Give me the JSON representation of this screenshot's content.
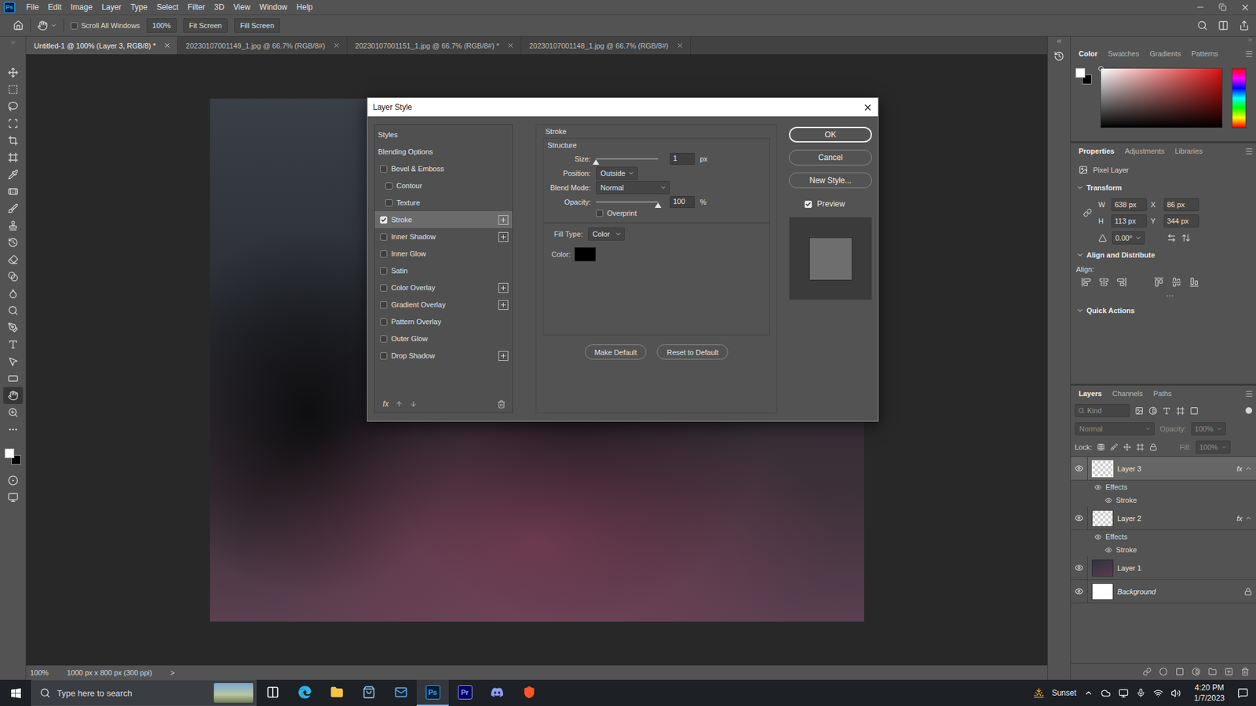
{
  "app": {
    "logo": "Ps"
  },
  "menu": [
    "File",
    "Edit",
    "Image",
    "Layer",
    "Type",
    "Select",
    "Filter",
    "3D",
    "View",
    "Window",
    "Help"
  ],
  "options_bar": {
    "scroll_all": {
      "label": "Scroll All Windows",
      "checked": false
    },
    "zoom": "100%",
    "buttons": [
      "Fit Screen",
      "Fill Screen"
    ]
  },
  "tabs": [
    {
      "label": "Untitled-1 @ 100% (Layer 3, RGB/8) *",
      "selected": true
    },
    {
      "label": "20230107001149_1.jpg @ 66.7% (RGB/8#)",
      "selected": false
    },
    {
      "label": "20230107001151_1.jpg @ 66.7% (RGB/8#) *",
      "selected": false
    },
    {
      "label": "20230107001148_1.jpg @ 66.7% (RGB/8#)",
      "selected": false
    }
  ],
  "tools": [
    {
      "selected": false
    },
    {
      "selected": false
    },
    {
      "selected": false
    },
    {
      "selected": false
    },
    {
      "selected": false
    },
    {
      "selected": false
    },
    {
      "selected": false
    },
    {
      "selected": false
    },
    {
      "selected": false
    },
    {
      "selected": false
    },
    {
      "selected": false
    },
    {
      "selected": false
    },
    {
      "selected": false
    },
    {
      "selected": false
    },
    {
      "selected": false
    },
    {
      "selected": false
    },
    {
      "selected": false
    },
    {
      "selected": false
    },
    {
      "selected": false
    },
    {
      "selected": true
    },
    {
      "selected": false
    },
    {
      "selected": false
    }
  ],
  "status_bar": {
    "zoom": "100%",
    "info": "1000 px x 800 px (300 ppi)",
    "arrow": ">"
  },
  "color_panel": {
    "tabs": [
      {
        "label": "Color",
        "selected": true
      },
      {
        "label": "Swatches",
        "selected": false
      },
      {
        "label": "Gradients",
        "selected": false
      },
      {
        "label": "Patterns",
        "selected": false
      }
    ],
    "foreground": "#ffffff",
    "background": "#000000"
  },
  "properties": {
    "tabs": [
      {
        "label": "Properties",
        "selected": true
      },
      {
        "label": "Adjustments",
        "selected": false
      },
      {
        "label": "Libraries",
        "selected": false
      }
    ],
    "layer_type": "Pixel Layer",
    "transform": {
      "title": "Transform",
      "expanded": true,
      "fields": [
        {
          "label": "W",
          "value": "638 px"
        },
        {
          "label": "X",
          "value": "86 px"
        },
        {
          "label": "H",
          "value": "113 px"
        },
        {
          "label": "Y",
          "value": "344 px"
        }
      ],
      "angle": "0.00°"
    },
    "align": {
      "title": "Align and Distribute",
      "expanded": true,
      "label": "Align:",
      "more": "···"
    },
    "quick_actions": {
      "title": "Quick Actions",
      "expanded": true
    }
  },
  "layers": {
    "tabs": [
      {
        "label": "Layers",
        "selected": true
      },
      {
        "label": "Channels",
        "selected": false
      },
      {
        "label": "Paths",
        "selected": false
      }
    ],
    "filter": {
      "placeholder": "Kind"
    },
    "blend": {
      "value": "Normal",
      "disabled": true
    },
    "opacity": {
      "label": "Opacity:",
      "value": "100%",
      "disabled": true
    },
    "lock": {
      "label": "Lock:"
    },
    "fill": {
      "label": "Fill:",
      "value": "100%",
      "disabled": true
    },
    "items": [
      {
        "name": "Layer 3",
        "kind": "transparent",
        "selected": true,
        "visible": true,
        "locked": false,
        "italic": false,
        "fx": "fx",
        "expanded": true,
        "effects_label": "Effects",
        "effects_visible": true,
        "effects": [
          {
            "name": "Stroke",
            "visible": true
          }
        ]
      },
      {
        "name": "Layer 2",
        "kind": "transparent",
        "selected": false,
        "visible": true,
        "locked": false,
        "italic": false,
        "fx": "fx",
        "expanded": true,
        "effects_label": "Effects",
        "effects_visible": true,
        "effects": [
          {
            "name": "Stroke",
            "visible": true
          }
        ]
      },
      {
        "name": "Layer 1",
        "kind": "photo",
        "selected": false,
        "visible": true,
        "locked": false,
        "italic": false
      },
      {
        "name": "Background",
        "kind": "fill",
        "selected": false,
        "visible": true,
        "locked": true,
        "italic": true
      }
    ]
  },
  "dialog": {
    "title": "Layer Style",
    "styles": [
      {
        "label": "Styles",
        "kind": "header",
        "selected": false
      },
      {
        "label": "Blending Options",
        "kind": "header",
        "selected": false
      },
      {
        "label": "Bevel & Emboss",
        "kind": "check",
        "checked": false,
        "addable": false,
        "selected": false
      },
      {
        "label": "Contour",
        "kind": "sub",
        "checked": false,
        "addable": false,
        "selected": false
      },
      {
        "label": "Texture",
        "kind": "sub",
        "checked": false,
        "addable": false,
        "selected": false
      },
      {
        "label": "Stroke",
        "kind": "check",
        "checked": true,
        "addable": true,
        "selected": true
      },
      {
        "label": "Inner Shadow",
        "kind": "check",
        "checked": false,
        "addable": true,
        "selected": false
      },
      {
        "label": "Inner Glow",
        "kind": "check",
        "checked": false,
        "addable": false,
        "selected": false
      },
      {
        "label": "Satin",
        "kind": "check",
        "checked": false,
        "addable": false,
        "selected": false
      },
      {
        "label": "Color Overlay",
        "kind": "check",
        "checked": false,
        "addable": true,
        "selected": false
      },
      {
        "label": "Gradient Overlay",
        "kind": "check",
        "checked": false,
        "addable": true,
        "selected": false
      },
      {
        "label": "Pattern Overlay",
        "kind": "check",
        "checked": false,
        "addable": false,
        "selected": false
      },
      {
        "label": "Outer Glow",
        "kind": "check",
        "checked": false,
        "addable": false,
        "selected": false
      },
      {
        "label": "Drop Shadow",
        "kind": "check",
        "checked": false,
        "addable": true,
        "selected": false
      }
    ],
    "footer": {
      "fx": "fx"
    },
    "stroke": {
      "title": "Stroke",
      "structure": {
        "title": "Structure",
        "size": {
          "label": "Size:",
          "value": "1",
          "unit": "px",
          "level": 0.0
        },
        "position": {
          "label": "Position:",
          "value": "Outside"
        },
        "blend_mode": {
          "label": "Blend Mode:",
          "value": "Normal"
        },
        "opacity": {
          "label": "Opacity:",
          "value": "100",
          "unit": "%",
          "level": 1.0
        },
        "overprint": {
          "label": "Overprint",
          "checked": false
        }
      },
      "fill": {
        "label": "Fill Type:",
        "value": "Color",
        "color_label": "Color:",
        "color": "#000000"
      },
      "buttons": [
        "Make Default",
        "Reset to Default"
      ]
    },
    "buttons": [
      {
        "label": "OK",
        "default": true
      },
      {
        "label": "Cancel",
        "default": false
      },
      {
        "label": "New Style...",
        "default": false
      }
    ],
    "preview": {
      "label": "Preview",
      "checked": true
    }
  },
  "taskbar": {
    "search": {
      "placeholder": "Type here to search"
    },
    "apps": [
      {
        "kind": "taskview",
        "label": "",
        "running": false
      },
      {
        "kind": "edge",
        "label": "",
        "running": false
      },
      {
        "kind": "explorer",
        "label": "",
        "running": false
      },
      {
        "kind": "store",
        "label": "",
        "running": false
      },
      {
        "kind": "mail",
        "label": "",
        "running": false
      },
      {
        "kind": "photoshop",
        "label": "Ps",
        "running": true
      },
      {
        "kind": "premiere",
        "label": "Pr",
        "running": false
      },
      {
        "kind": "discord",
        "label": "",
        "running": false
      },
      {
        "kind": "brave",
        "label": "",
        "running": false
      }
    ],
    "weather": "Sunset",
    "time": "4:20 PM",
    "date": "1/7/2023"
  }
}
